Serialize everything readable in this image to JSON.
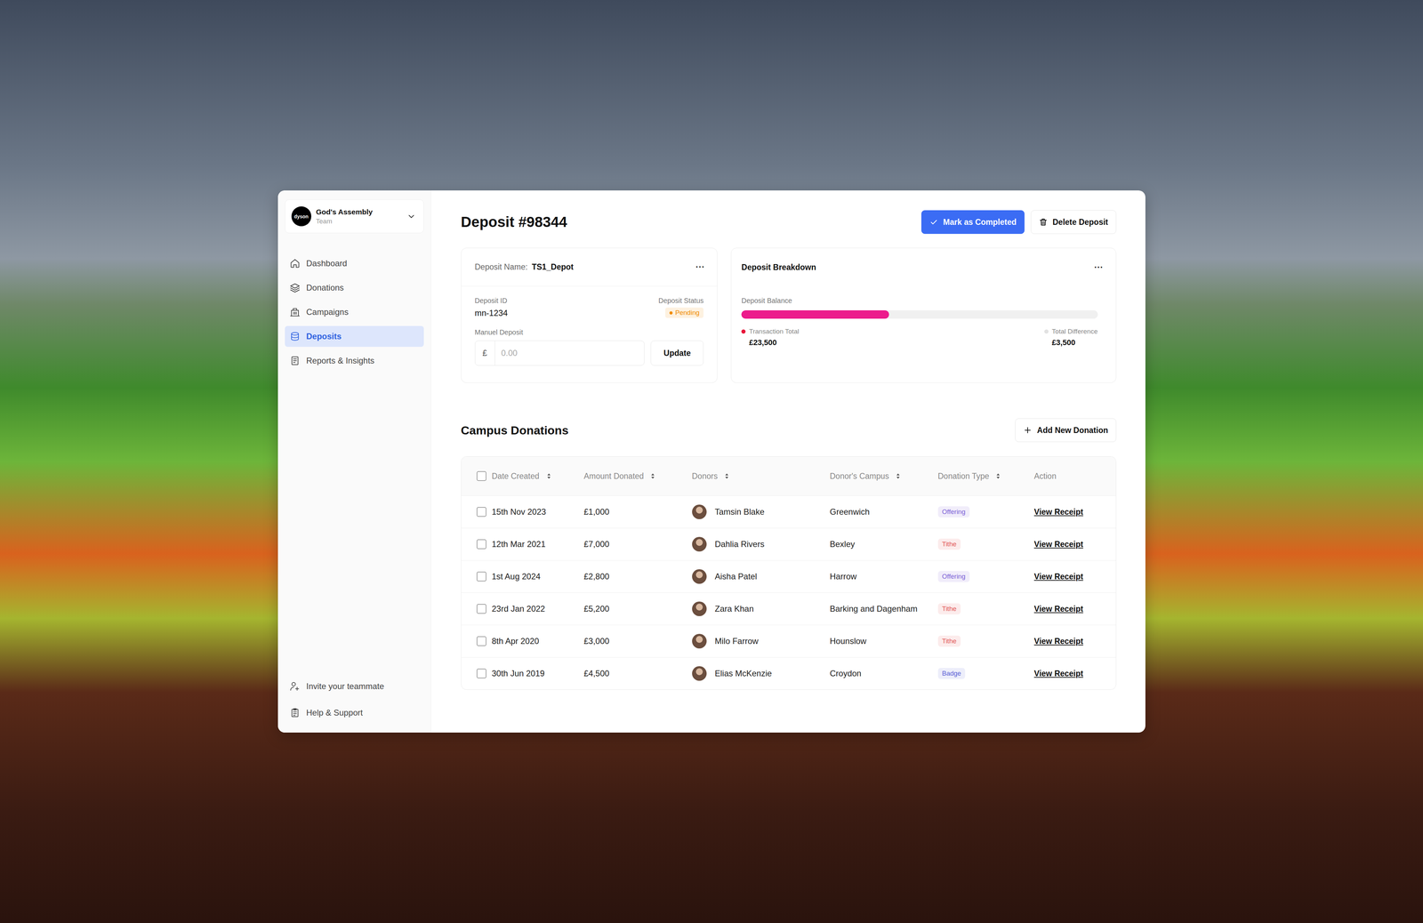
{
  "team": {
    "logo": "dyson",
    "name": "God's Assembly",
    "subtitle": "Team"
  },
  "sidebar": {
    "items": [
      {
        "label": "Dashboard",
        "selected": false
      },
      {
        "label": "Donations",
        "selected": false
      },
      {
        "label": "Campaigns",
        "selected": false
      },
      {
        "label": "Deposits",
        "selected": true
      },
      {
        "label": "Reports & Insights",
        "selected": false
      }
    ],
    "footer": [
      "Invite your teammate",
      "Help & Support"
    ]
  },
  "header": {
    "title": "Deposit #98344",
    "buttons": [
      {
        "label": "Mark as Completed",
        "kind": "primary"
      },
      {
        "label": "Delete Deposit",
        "kind": "secondary"
      }
    ]
  },
  "deposit_card": {
    "name_label": "Deposit Name:",
    "name": "TS1_Depot",
    "more": "···",
    "id_label": "Deposit ID",
    "id": "mn-1234",
    "status_label": "Deposit Status",
    "status": "Pending",
    "status_color": "#f08c00",
    "manual_label": "Manuel Deposit",
    "currency": "£",
    "placeholder": "0.00",
    "button": "Update"
  },
  "breakdown": {
    "title": "Deposit Breakdown",
    "more": "···",
    "balance_label": "Deposit Balance",
    "level": 0.414,
    "legend": [
      {
        "label": "Transaction Total",
        "value": "£23,500",
        "color": "#e8173a"
      },
      {
        "label": "Total Difference",
        "value": "£3,500",
        "color": "#e2e2e2"
      }
    ]
  },
  "donations": {
    "title": "Campus Donations",
    "add_button": "Add New Donation",
    "all_checked": false,
    "columns": [
      {
        "label": "Date Created",
        "sortable": true
      },
      {
        "label": "Amount Donated",
        "sortable": true
      },
      {
        "label": "Donors",
        "sortable": true
      },
      {
        "label": "Donor's Campus",
        "sortable": true
      },
      {
        "label": "Donation Type",
        "sortable": true
      },
      {
        "label": "Action",
        "sortable": false
      }
    ],
    "rows": [
      {
        "date": "15th Nov 2023",
        "amount": "£1,000",
        "donor": "Tamsin Blake",
        "campus": "Greenwich",
        "type": "Offering",
        "type_color": "#7b5fd6",
        "action": "View Receipt",
        "checked": false
      },
      {
        "date": "12th Mar 2021",
        "amount": "£7,000",
        "donor": "Dahlia Rivers",
        "campus": "Bexley",
        "type": "Tithe",
        "type_color": "#e05656",
        "action": "View Receipt",
        "checked": false
      },
      {
        "date": "1st Aug 2024",
        "amount": "£2,800",
        "donor": "Aisha Patel",
        "campus": "Harrow",
        "type": "Offering",
        "type_color": "#7b5fd6",
        "action": "View Receipt",
        "checked": false
      },
      {
        "date": "23rd Jan 2022",
        "amount": "£5,200",
        "donor": "Zara Khan",
        "campus": "Barking and Dagenham",
        "type": "Tithe",
        "type_color": "#e05656",
        "action": "View Receipt",
        "checked": false
      },
      {
        "date": "8th Apr 2020",
        "amount": "£3,000",
        "donor": "Milo Farrow",
        "campus": "Hounslow",
        "type": "Tithe",
        "type_color": "#e05656",
        "action": "View Receipt",
        "checked": false
      },
      {
        "date": "30th Jun 2019",
        "amount": "£4,500",
        "donor": "Elias McKenzie",
        "campus": "Croydon",
        "type": "Badge",
        "type_color": "#5c62d6",
        "action": "View Receipt",
        "checked": false
      }
    ]
  }
}
